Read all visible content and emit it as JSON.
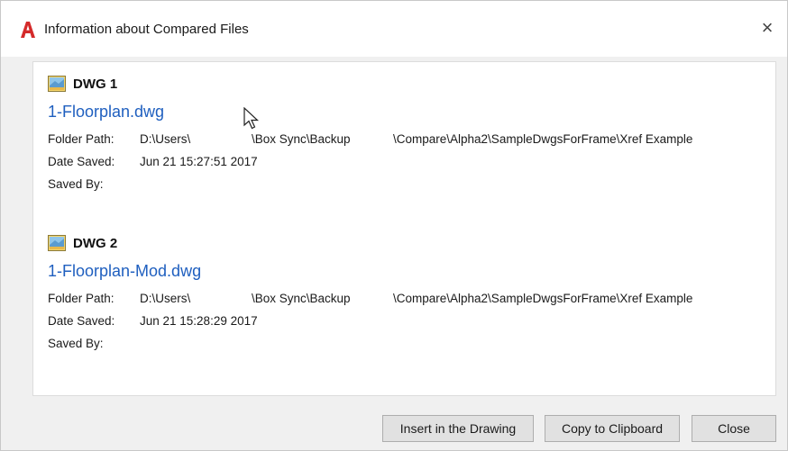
{
  "window": {
    "title": "Information about Compared Files",
    "close_glyph": "×"
  },
  "icons": {
    "app": "autocad-a-icon",
    "dwg": "dwg-file-icon",
    "close": "close-icon",
    "cursor": "mouse-pointer-icon"
  },
  "colors": {
    "app_icon": "#d42a2a",
    "link": "#1f5fbf"
  },
  "dwg1": {
    "heading": "DWG 1",
    "file_name": "1-Floorplan.dwg",
    "folder_label": "Folder Path:",
    "folder_seg1": "D:\\Users\\",
    "folder_seg2": "\\Box Sync\\Backup",
    "folder_seg3": "\\Compare\\Alpha2\\SampleDwgsForFrame\\Xref Example",
    "date_label": "Date Saved:",
    "date_value": "Jun 21 15:27:51 2017",
    "saved_by_label": "Saved By:",
    "saved_by_value": ""
  },
  "dwg2": {
    "heading": "DWG 2",
    "file_name": "1-Floorplan-Mod.dwg",
    "folder_label": "Folder Path:",
    "folder_seg1": "D:\\Users\\",
    "folder_seg2": "\\Box Sync\\Backup",
    "folder_seg3": "\\Compare\\Alpha2\\SampleDwgsForFrame\\Xref Example",
    "date_label": "Date Saved:",
    "date_value": "Jun 21 15:28:29 2017",
    "saved_by_label": "Saved By:",
    "saved_by_value": ""
  },
  "buttons": {
    "insert": "Insert in the Drawing",
    "copy": "Copy to Clipboard",
    "close": "Close"
  }
}
